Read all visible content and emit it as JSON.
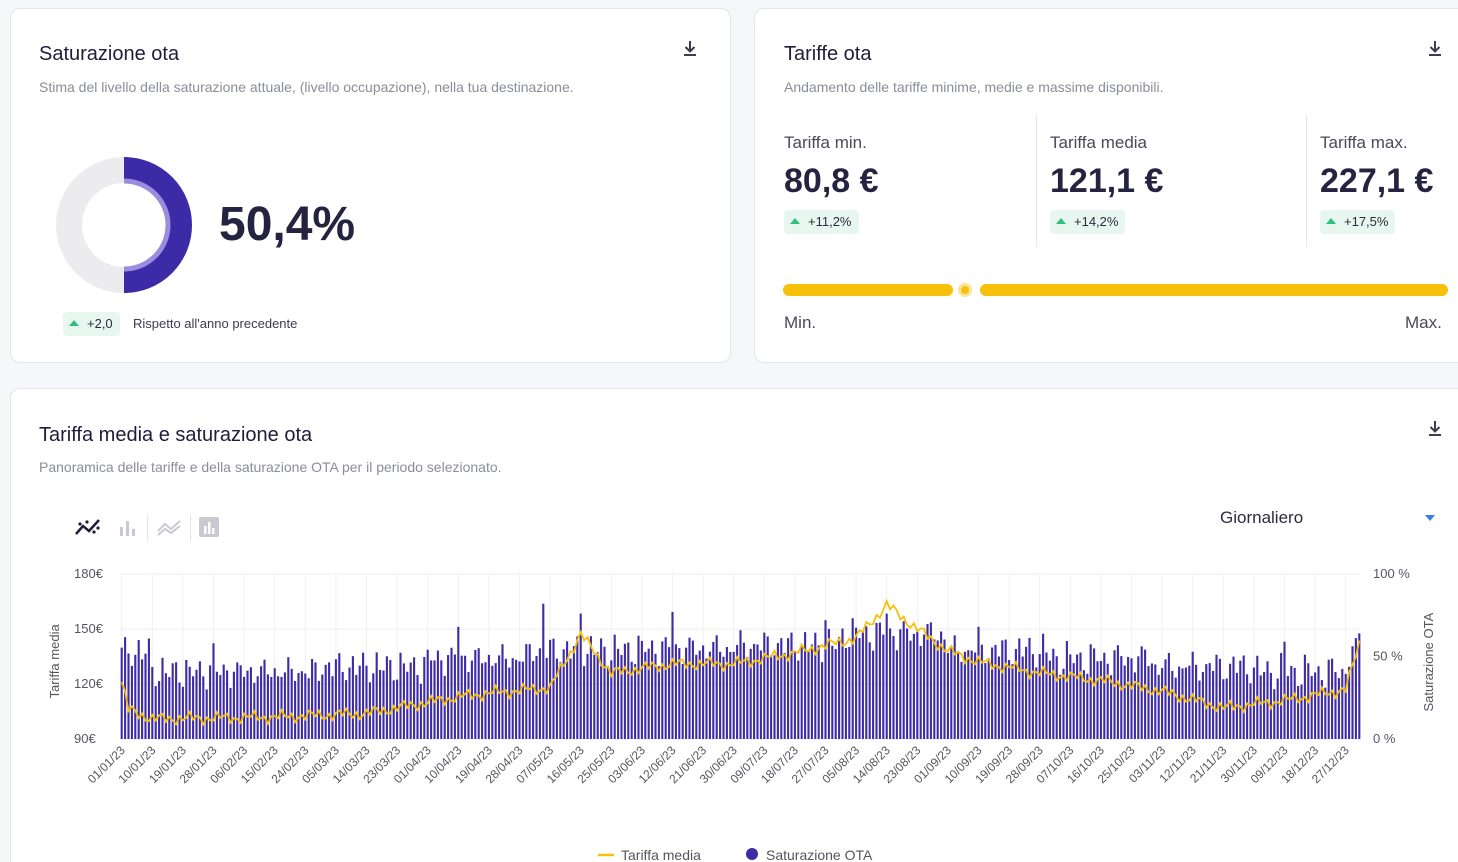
{
  "saturation_card": {
    "title": "Saturazione ota",
    "subtitle": "Stima del livello della saturazione attuale, (livello occupazione), nella tua destinazione.",
    "value": "50,4%",
    "percent": 50.4,
    "change": "+2,0",
    "change_note": "Rispetto all'anno precedente"
  },
  "rates_card": {
    "title": "Tariffe ota",
    "subtitle": "Andamento delle tariffe minime, medie e massime disponibili.",
    "min": {
      "label": "Tariffa min.",
      "value": "80,8 €",
      "change": "+11,2%"
    },
    "avg": {
      "label": "Tariffa media",
      "value": "121,1 €",
      "change": "+14,2%"
    },
    "max": {
      "label": "Tariffa max.",
      "value": "227,1 €",
      "change": "+17,5%"
    },
    "range": {
      "min_label": "Min.",
      "max_label": "Max.",
      "avg_position": 0.27
    }
  },
  "chart_card": {
    "title": "Tariffa media e saturazione ota",
    "subtitle": "Panoramica delle tariffe e della saturazione OTA per il periodo selezionato.",
    "period_select": "Giornaliero",
    "view_icons": [
      "line-scatter-icon",
      "bar-chart-icon",
      "area-chart-icon",
      "stacked-bar-icon"
    ]
  },
  "colors": {
    "primary": "#3d2aa6",
    "primary_light": "#9b8ce0",
    "accent": "#f7c00b",
    "positive": "#2fbf7c",
    "positive_bg": "#e7f7ef"
  },
  "chart_data": {
    "type": "bar",
    "x_start": "01/01/23",
    "x_end": "31/12/23",
    "x_tick_labels": [
      "01/01/23",
      "10/01/23",
      "19/01/23",
      "28/01/23",
      "06/02/23",
      "15/02/23",
      "24/02/23",
      "05/03/23",
      "14/03/23",
      "23/03/23",
      "01/04/23",
      "10/04/23",
      "19/04/23",
      "28/04/23",
      "07/05/23",
      "16/05/23",
      "25/05/23",
      "03/06/23",
      "12/06/23",
      "21/06/23",
      "30/06/23",
      "09/07/23",
      "18/07/23",
      "27/07/23",
      "05/08/23",
      "14/08/23",
      "23/08/23",
      "01/09/23",
      "10/09/23",
      "19/09/23",
      "28/09/23",
      "07/10/23",
      "16/10/23",
      "25/10/23",
      "03/11/23",
      "12/11/23",
      "21/11/23",
      "30/11/23",
      "09/12/23",
      "18/12/23",
      "27/12/23"
    ],
    "left_axis": {
      "label": "Tariffa media",
      "ticks": [
        "180€",
        "150€",
        "120€",
        "90€"
      ],
      "range": [
        90,
        180
      ]
    },
    "right_axis": {
      "label": "Saturazione OTA",
      "ticks": [
        "100 %",
        "50 %",
        "0 %"
      ],
      "range": [
        0,
        100
      ]
    },
    "series": [
      {
        "name": "Saturazione OTA",
        "kind": "bar",
        "axis": "right",
        "color": "#3d2aa6",
        "monthly_profile": [
          {
            "from": "01/01/23",
            "value": 52
          },
          {
            "from": "10/01/23",
            "value": 40
          },
          {
            "from": "01/03/23",
            "value": 43
          },
          {
            "from": "01/04/23",
            "value": 48
          },
          {
            "from": "01/05/23",
            "value": 53
          },
          {
            "from": "01/06/23",
            "value": 54
          },
          {
            "from": "01/07/23",
            "value": 56
          },
          {
            "from": "01/08/23",
            "value": 63
          },
          {
            "from": "01/09/23",
            "value": 53
          },
          {
            "from": "01/10/23",
            "value": 48
          },
          {
            "from": "01/11/23",
            "value": 43
          },
          {
            "from": "01/12/23",
            "value": 40
          },
          {
            "from": "28/12/23",
            "value": 52
          }
        ],
        "peaks": [
          {
            "x": "28/01/23",
            "value": 58
          },
          {
            "x": "10/04/23",
            "value": 68
          },
          {
            "x": "05/05/23",
            "value": 82
          },
          {
            "x": "16/05/23",
            "value": 76
          },
          {
            "x": "12/06/23",
            "value": 77
          },
          {
            "x": "27/07/23",
            "value": 72
          },
          {
            "x": "14/08/23",
            "value": 76
          },
          {
            "x": "10/09/23",
            "value": 68
          },
          {
            "x": "09/12/23",
            "value": 59
          },
          {
            "x": "31/12/23",
            "value": 64
          }
        ]
      },
      {
        "name": "Tariffa media",
        "kind": "line",
        "axis": "left",
        "color": "#f7c00b",
        "points": [
          {
            "x": "01/01/23",
            "y": 121
          },
          {
            "x": "03/01/23",
            "y": 106
          },
          {
            "x": "10/01/23",
            "y": 101
          },
          {
            "x": "15/02/23",
            "y": 102
          },
          {
            "x": "14/03/23",
            "y": 104
          },
          {
            "x": "10/04/23",
            "y": 113
          },
          {
            "x": "19/04/23",
            "y": 115
          },
          {
            "x": "07/05/23",
            "y": 118
          },
          {
            "x": "16/05/23",
            "y": 147
          },
          {
            "x": "25/05/23",
            "y": 126
          },
          {
            "x": "12/06/23",
            "y": 131
          },
          {
            "x": "30/06/23",
            "y": 131
          },
          {
            "x": "18/07/23",
            "y": 137
          },
          {
            "x": "05/08/23",
            "y": 145
          },
          {
            "x": "14/08/23",
            "y": 163
          },
          {
            "x": "23/08/23",
            "y": 150
          },
          {
            "x": "01/09/23",
            "y": 138
          },
          {
            "x": "10/09/23",
            "y": 132
          },
          {
            "x": "28/09/23",
            "y": 126
          },
          {
            "x": "16/10/23",
            "y": 122
          },
          {
            "x": "03/11/23",
            "y": 116
          },
          {
            "x": "21/11/23",
            "y": 107
          },
          {
            "x": "09/12/23",
            "y": 111
          },
          {
            "x": "27/12/23",
            "y": 117
          },
          {
            "x": "31/12/23",
            "y": 142
          }
        ]
      }
    ],
    "legend": [
      "Tariffa media",
      "Saturazione OTA"
    ],
    "legend_position": "bottom",
    "grid": true
  }
}
